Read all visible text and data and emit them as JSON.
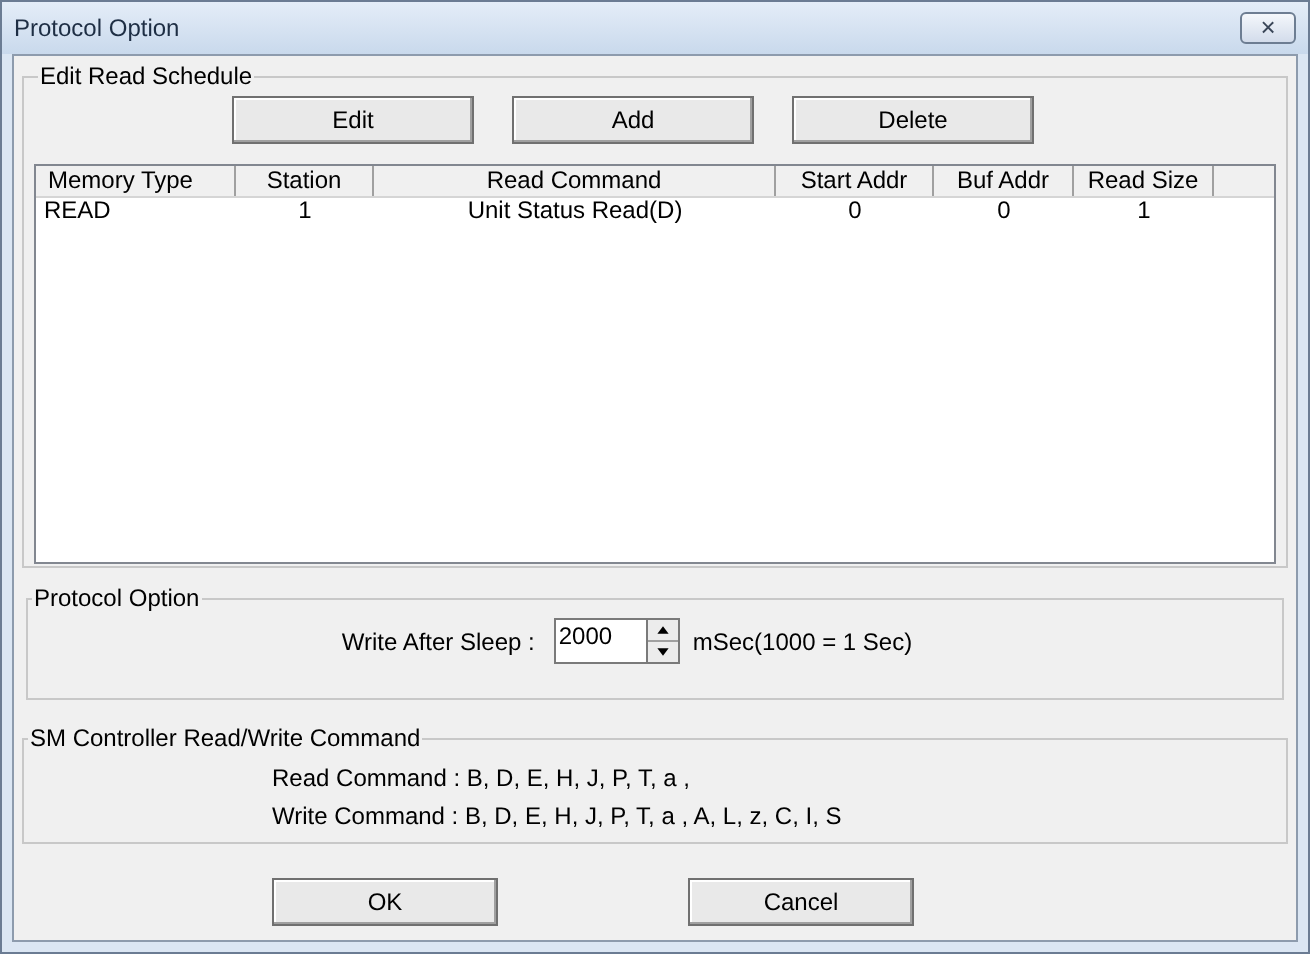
{
  "window": {
    "title": "Protocol Option",
    "close_button": "×"
  },
  "edit_read_schedule": {
    "title": "Edit Read Schedule",
    "buttons": [
      "Edit",
      "Add",
      "Delete"
    ],
    "table": {
      "columns": [
        "Memory Type",
        "Station",
        "Read Command",
        "Start Addr",
        "Buf Addr",
        "Read Size"
      ],
      "rows": [
        [
          "READ",
          "1",
          "Unit Status Read(D)",
          "0",
          "0",
          "1"
        ]
      ]
    }
  },
  "protocol_option": {
    "title": "Protocol Option",
    "label": "Write After Sleep :",
    "value": "2000",
    "unit": "mSec(1000 = 1 Sec)"
  },
  "sm_controller": {
    "title": "SM Controller Read/Write Command",
    "lines": [
      "Read Command : B, D, E, H, J, P, T, a ,",
      "Write Command : B, D, E, H, J, P, T, a , A, L, z, C, I, S"
    ]
  },
  "buttons": [
    "OK",
    "Cancel"
  ]
}
